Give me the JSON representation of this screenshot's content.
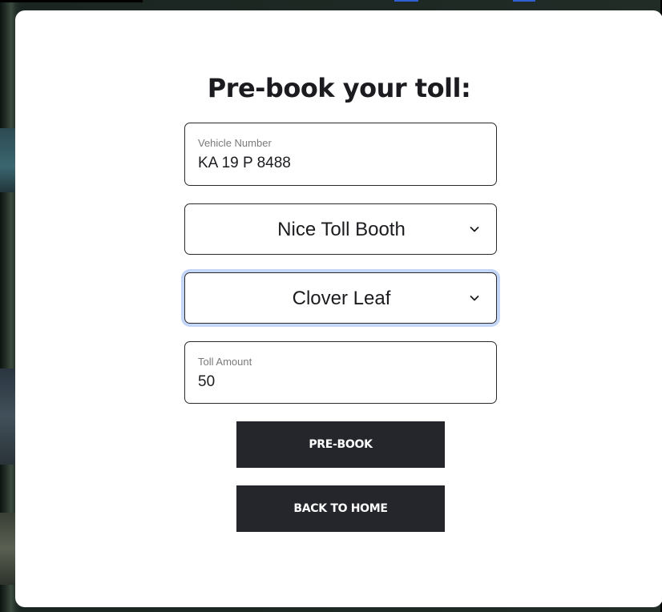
{
  "modal": {
    "title": "Pre-book your toll:"
  },
  "vehicle": {
    "label": "Vehicle Number",
    "value": "KA 19 P 8488"
  },
  "toll_booth": {
    "selected": "Nice Toll Booth",
    "icon": "chevron-down-icon"
  },
  "destination": {
    "selected": "Clover Leaf",
    "icon": "chevron-down-icon"
  },
  "toll_amount": {
    "label": "Toll Amount",
    "value": "50"
  },
  "buttons": {
    "prebook": "PRE-BOOK",
    "back_home": "BACK TO HOME"
  },
  "colors": {
    "button_bg": "#24262b",
    "focus_ring": "#c3d6f7",
    "text": "#1c1c20"
  }
}
